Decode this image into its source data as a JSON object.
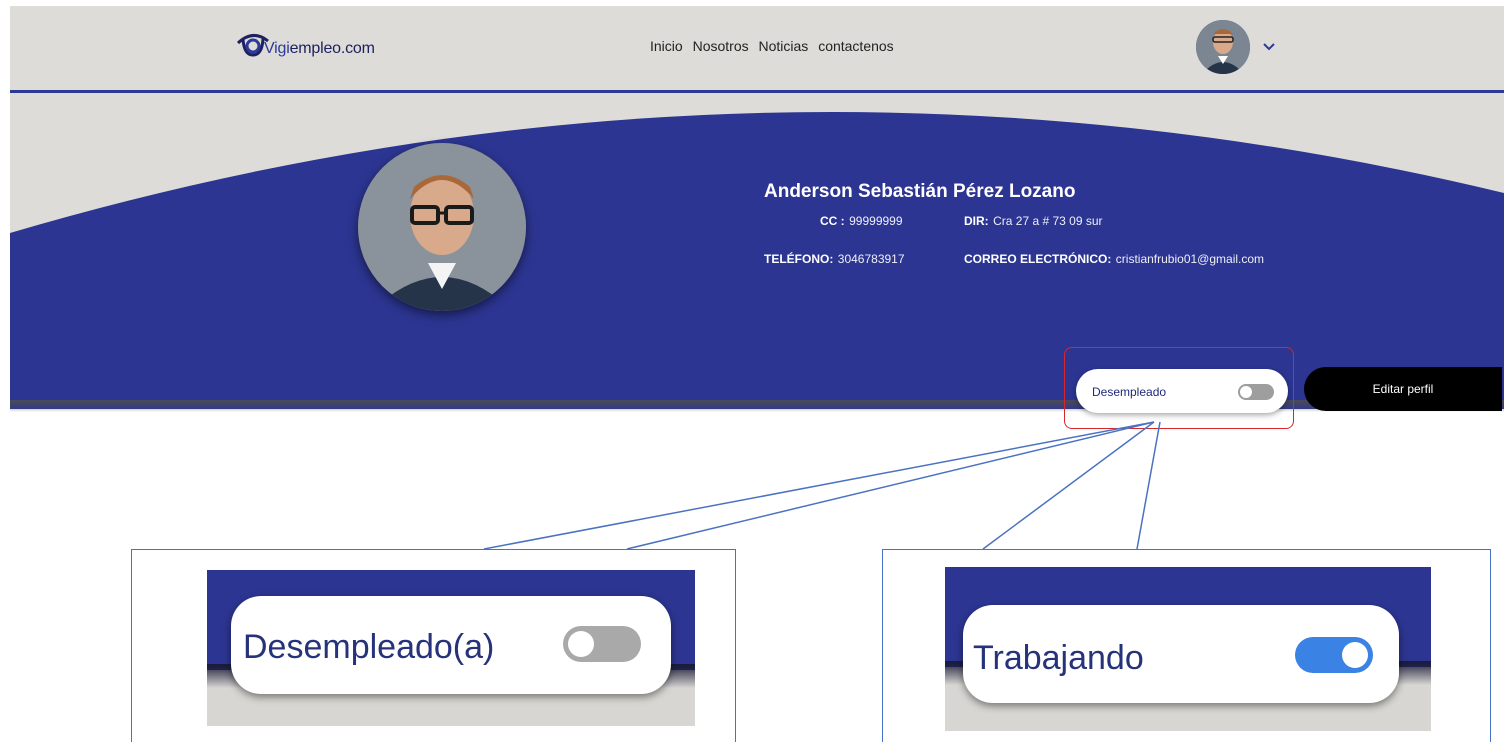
{
  "header": {
    "logo_text_accent": "Vigi",
    "logo_text_rest": "empleo.com",
    "nav": [
      "Inicio",
      "Nosotros",
      "Noticias",
      "contactenos"
    ]
  },
  "profile": {
    "name": "Anderson Sebastián Pérez Lozano",
    "cc_label": "CC :",
    "cc_value": "99999999",
    "dir_label": "DIR:",
    "dir_value": "Cra 27 a # 73 09 sur",
    "tel_label": "TELÉFONO:",
    "tel_value": "3046783917",
    "mail_label": "CORREO ELECTRÓNICO:",
    "mail_value": "cristianfrubio01@gmail.com"
  },
  "status": {
    "label": "Desempleado",
    "toggle_on": false
  },
  "edit_button": "Editar perfil",
  "callouts": {
    "left": {
      "label": "Desempleado(a)",
      "toggle_on": false
    },
    "right": {
      "label": "Trabajando",
      "toggle_on": true
    }
  },
  "colors": {
    "banner_blue": "#2c3591",
    "header_bg": "#dedcd8",
    "highlight_red": "#d9262b",
    "callout_line": "#4a72c2",
    "toggle_on": "#3a82e4",
    "toggle_off": "#a9a9a9"
  }
}
